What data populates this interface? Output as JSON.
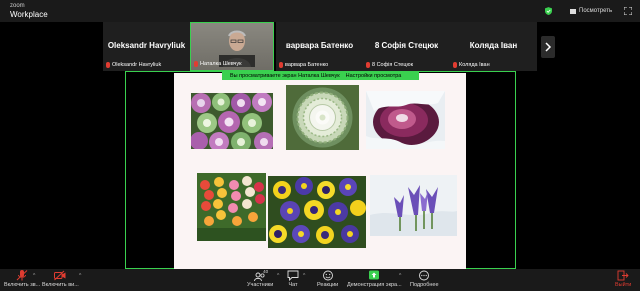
{
  "app": {
    "brand_top": "zoom",
    "brand_bottom": "Workplace",
    "view_label": "Посмотреть"
  },
  "gallery": [
    {
      "name": "Oleksandr Havryliuk",
      "label": "Oleksandr Havryliuk",
      "video": false
    },
    {
      "name": "",
      "label": "Наталка Шевчук",
      "video": true
    },
    {
      "name": "варвара Батенко",
      "label": "варвара Батенко",
      "video": false
    },
    {
      "name": "8 Софія Стецюк",
      "label": "8 Софія Стецюк",
      "video": false
    },
    {
      "name": "Коляда Іван",
      "label": "Коляда Іван",
      "video": false
    }
  ],
  "share": {
    "banner_text": "Вы просматриваете экран  Наталка Шевчук",
    "banner_settings": "Настройки просмотра"
  },
  "toolbar": {
    "mute": "Включить зв...",
    "video": "Включить ви...",
    "participants": "Участники",
    "participants_count": "40",
    "chat": "Чат",
    "reactions": "Реакции",
    "share_screen": "Демонстрация экра...",
    "more": "Подробнее",
    "leave": "Выйти"
  },
  "colors": {
    "accent_green": "#3ad04f",
    "muted_red": "#e03c31",
    "toolbar_bg": "#1a1a1a",
    "tile_bg": "#1f1f1f"
  }
}
